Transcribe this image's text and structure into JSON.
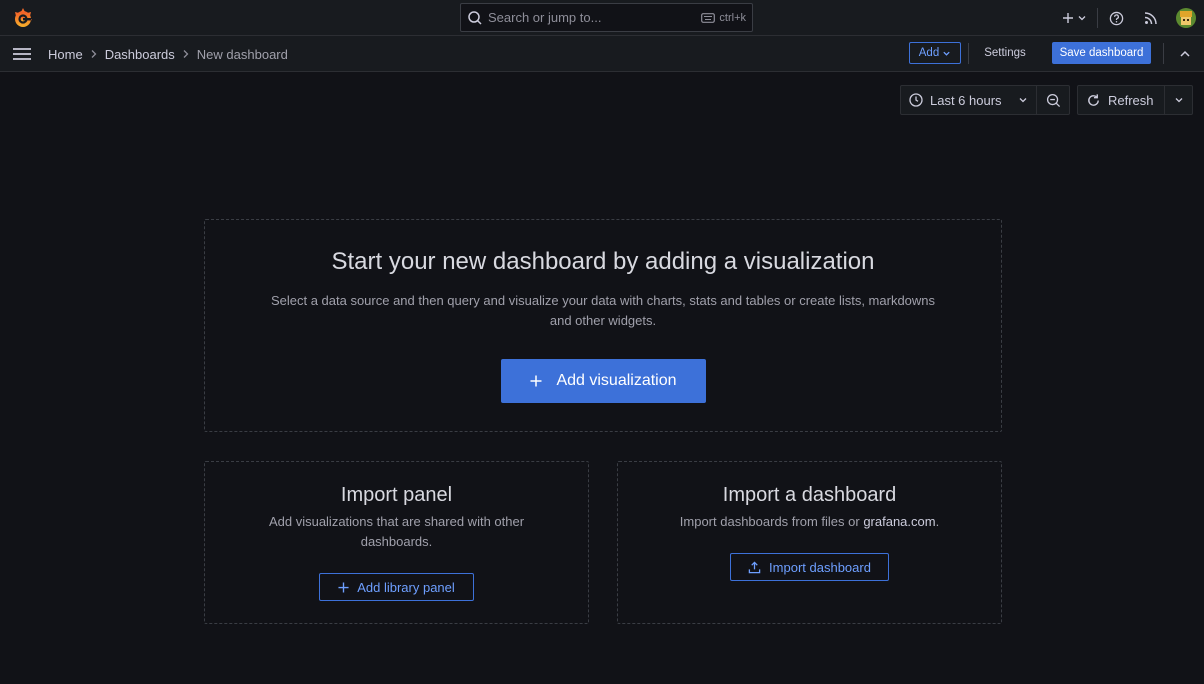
{
  "topbar": {
    "search_placeholder": "Search or jump to...",
    "search_shortcut": "ctrl+k",
    "icons": [
      "grafana-logo-icon",
      "plus-icon",
      "help-icon",
      "rss-icon",
      "avatar"
    ]
  },
  "breadcrumb": {
    "items": [
      "Home",
      "Dashboards",
      "New dashboard"
    ]
  },
  "toolbar": {
    "add_label": "Add",
    "settings_label": "Settings",
    "save_label": "Save dashboard"
  },
  "time": {
    "range_label": "Last 6 hours",
    "refresh_label": "Refresh"
  },
  "main": {
    "title": "Start your new dashboard by adding a visualization",
    "description": "Select a data source and then query and visualize your data with charts, stats and tables or create lists, markdowns and other widgets.",
    "button_label": "Add visualization"
  },
  "import_panel": {
    "title": "Import panel",
    "description": "Add visualizations that are shared with other dashboards.",
    "button_label": "Add library panel"
  },
  "import_dashboard": {
    "title": "Import a dashboard",
    "description_prefix": "Import dashboards from files or",
    "description_link": "grafana.com",
    "description_suffix": ".",
    "button_label": "Import dashboard"
  },
  "colors": {
    "background": "#111217",
    "header": "#181b1f",
    "primary": "#3d71d9",
    "primary_text": "#6e9fff"
  }
}
